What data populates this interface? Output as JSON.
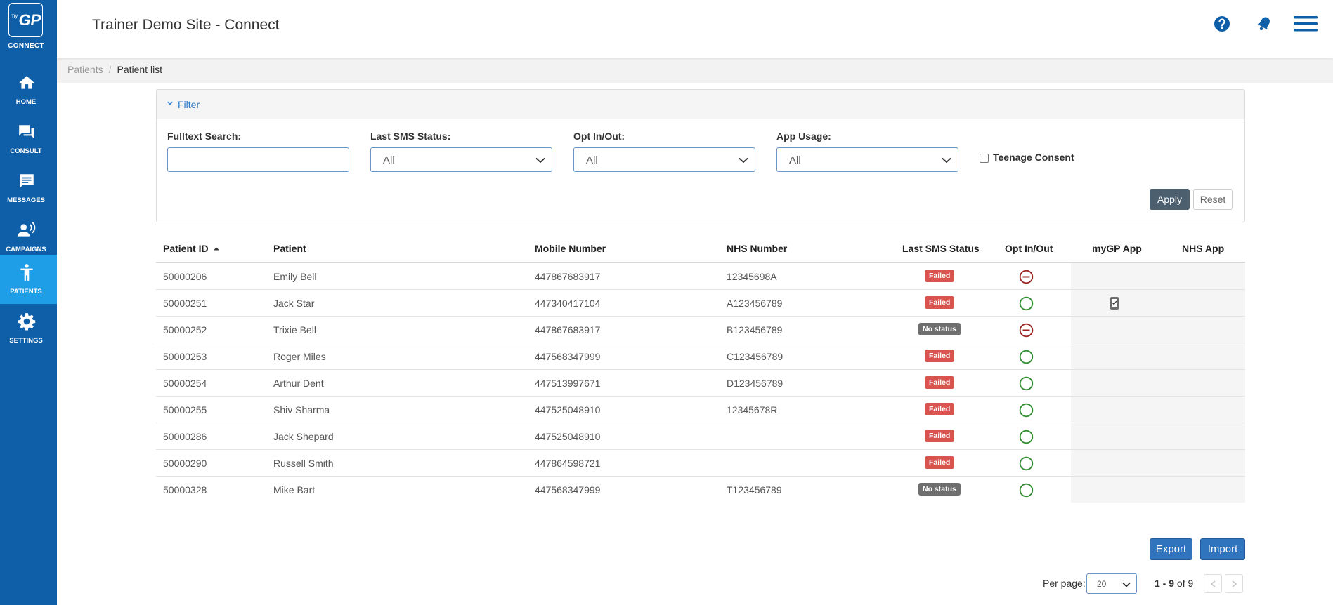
{
  "app": {
    "logo_text": "GP",
    "logo_prefix": "my",
    "logo_caption": "CONNECT",
    "title": "Trainer Demo Site - Connect"
  },
  "nav": [
    {
      "label": "HOME",
      "icon": "home-icon"
    },
    {
      "label": "CONSULT",
      "icon": "consult-icon"
    },
    {
      "label": "MESSAGES",
      "icon": "messages-icon"
    },
    {
      "label": "CAMPAIGNS",
      "icon": "campaigns-icon"
    },
    {
      "label": "PATIENTS",
      "icon": "patients-icon",
      "active": true
    },
    {
      "label": "SETTINGS",
      "icon": "settings-icon"
    }
  ],
  "breadcrumb": {
    "root": "Patients",
    "separator": "/",
    "current": "Patient list"
  },
  "filter": {
    "title": "Filter",
    "fulltext_label": "Fulltext Search:",
    "fulltext_value": "",
    "sms_label": "Last SMS Status:",
    "sms_value": "All",
    "opt_label": "Opt In/Out:",
    "opt_value": "All",
    "app_label": "App Usage:",
    "app_value": "All",
    "teen_label": "Teenage Consent",
    "apply_label": "Apply",
    "reset_label": "Reset"
  },
  "table": {
    "headers": {
      "id": "Patient ID",
      "patient": "Patient",
      "mobile": "Mobile Number",
      "nhs": "NHS Number",
      "sms": "Last SMS Status",
      "opt": "Opt In/Out",
      "mygp": "myGP App",
      "nhsapp": "NHS App"
    },
    "rows": [
      {
        "id": "50000206",
        "patient": "Emily Bell",
        "mobile": "447867683917",
        "nhs": "12345698A",
        "sms": "Failed",
        "opt": "out",
        "mygp": false
      },
      {
        "id": "50000251",
        "patient": "Jack Star",
        "mobile": "447340417104",
        "nhs": "A123456789",
        "sms": "Failed",
        "opt": "in",
        "mygp": true
      },
      {
        "id": "50000252",
        "patient": "Trixie Bell",
        "mobile": "447867683917",
        "nhs": "B123456789",
        "sms": "No status",
        "opt": "out",
        "mygp": false
      },
      {
        "id": "50000253",
        "patient": "Roger Miles",
        "mobile": "447568347999",
        "nhs": "C123456789",
        "sms": "Failed",
        "opt": "in",
        "mygp": false
      },
      {
        "id": "50000254",
        "patient": "Arthur Dent",
        "mobile": "447513997671",
        "nhs": "D123456789",
        "sms": "Failed",
        "opt": "in",
        "mygp": false
      },
      {
        "id": "50000255",
        "patient": "Shiv Sharma",
        "mobile": "447525048910",
        "nhs": "12345678R",
        "sms": "Failed",
        "opt": "in",
        "mygp": false
      },
      {
        "id": "50000286",
        "patient": "Jack Shepard",
        "mobile": "447525048910",
        "nhs": "",
        "sms": "Failed",
        "opt": "in",
        "mygp": false
      },
      {
        "id": "50000290",
        "patient": "Russell Smith",
        "mobile": "447864598721",
        "nhs": "",
        "sms": "Failed",
        "opt": "in",
        "mygp": false
      },
      {
        "id": "50000328",
        "patient": "Mike Bart",
        "mobile": "447568347999",
        "nhs": "T123456789",
        "sms": "No status",
        "opt": "in",
        "mygp": false
      }
    ]
  },
  "actions": {
    "export_label": "Export",
    "import_label": "Import"
  },
  "pagination": {
    "per_page_label": "Per page:",
    "per_page_value": "20",
    "range": "1 - 9",
    "of_label": "of 9"
  },
  "colors": {
    "sidebar": "#0e5fa8",
    "active_nav": "#1f9ee8",
    "failed": "#d9534f",
    "no_status": "#6f6f6f",
    "opt_in": "#2e8b2e",
    "opt_out": "#9b2020"
  }
}
